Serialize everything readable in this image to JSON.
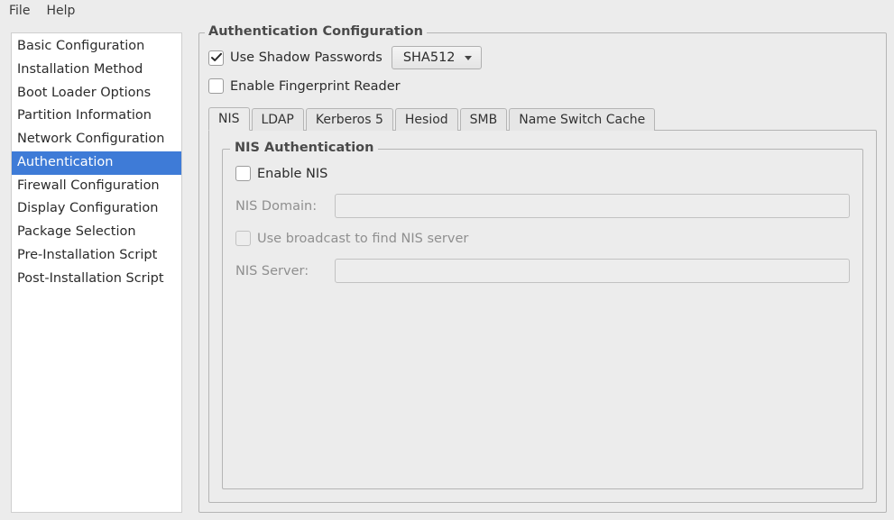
{
  "menubar": {
    "file": "File",
    "help": "Help"
  },
  "sidebar": {
    "items": [
      "Basic Configuration",
      "Installation Method",
      "Boot Loader Options",
      "Partition Information",
      "Network Configuration",
      "Authentication",
      "Firewall Configuration",
      "Display Configuration",
      "Package Selection",
      "Pre-Installation Script",
      "Post-Installation Script"
    ],
    "selected_index": 5
  },
  "main": {
    "group_title": "Authentication Configuration",
    "shadow_passwords": {
      "label": "Use Shadow Passwords",
      "checked": true
    },
    "hash_combo": {
      "value": "SHA512"
    },
    "fingerprint": {
      "label": "Enable Fingerprint Reader",
      "checked": false
    },
    "tabs": [
      "NIS",
      "LDAP",
      "Kerberos 5",
      "Hesiod",
      "SMB",
      "Name Switch Cache"
    ],
    "active_tab_index": 0,
    "nis_group_title": "NIS Authentication",
    "enable_nis": {
      "label": "Enable NIS",
      "checked": false
    },
    "nis_domain_label": "NIS Domain:",
    "nis_domain_value": "",
    "broadcast": {
      "label": "Use broadcast to find NIS server",
      "checked": false,
      "disabled": true
    },
    "nis_server_label": "NIS Server:",
    "nis_server_value": ""
  }
}
